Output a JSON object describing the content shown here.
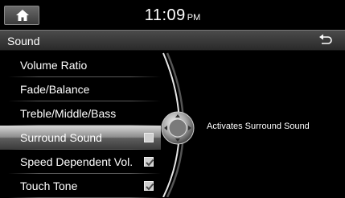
{
  "status_bar": {
    "home_icon": "home-icon",
    "time": "11:09",
    "ampm": "PM"
  },
  "title_bar": {
    "title": "Sound",
    "back_icon": "back-arrow-icon"
  },
  "menu": {
    "items": [
      {
        "label": "Volume Ratio",
        "checkbox": null
      },
      {
        "label": "Fade/Balance",
        "checkbox": null
      },
      {
        "label": "Treble/Middle/Bass",
        "checkbox": null
      },
      {
        "label": "Surround Sound",
        "checkbox": false,
        "selected": true
      },
      {
        "label": "Speed Dependent Vol.",
        "checkbox": true
      },
      {
        "label": "Touch Tone",
        "checkbox": true
      }
    ]
  },
  "description": "Activates Surround Sound",
  "colors": {
    "background": "#000000",
    "selected_highlight": "#bdbdbd",
    "text": "#ffffff"
  }
}
